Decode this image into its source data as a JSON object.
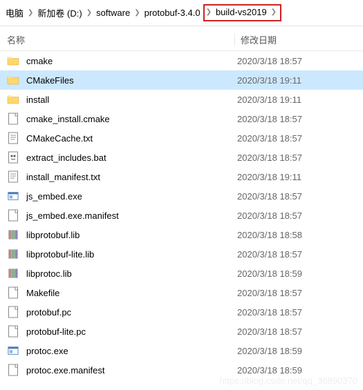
{
  "breadcrumb": {
    "items": [
      {
        "label": "电脑"
      },
      {
        "label": "新加卷 (D:)"
      },
      {
        "label": "software"
      },
      {
        "label": "protobuf-3.4.0"
      },
      {
        "label": "build-vs2019",
        "highlighted": true
      }
    ]
  },
  "columns": {
    "name": "名称",
    "date": "修改日期"
  },
  "files": [
    {
      "name": "cmake",
      "date": "2020/3/18 18:57",
      "type": "folder"
    },
    {
      "name": "CMakeFiles",
      "date": "2020/3/18 19:11",
      "type": "folder",
      "selected": true
    },
    {
      "name": "install",
      "date": "2020/3/18 19:11",
      "type": "folder"
    },
    {
      "name": "cmake_install.cmake",
      "date": "2020/3/18 18:57",
      "type": "file"
    },
    {
      "name": "CMakeCache.txt",
      "date": "2020/3/18 18:57",
      "type": "txt"
    },
    {
      "name": "extract_includes.bat",
      "date": "2020/3/18 18:57",
      "type": "bat"
    },
    {
      "name": "install_manifest.txt",
      "date": "2020/3/18 19:11",
      "type": "txt"
    },
    {
      "name": "js_embed.exe",
      "date": "2020/3/18 18:57",
      "type": "exe"
    },
    {
      "name": "js_embed.exe.manifest",
      "date": "2020/3/18 18:57",
      "type": "file"
    },
    {
      "name": "libprotobuf.lib",
      "date": "2020/3/18 18:58",
      "type": "lib"
    },
    {
      "name": "libprotobuf-lite.lib",
      "date": "2020/3/18 18:57",
      "type": "lib"
    },
    {
      "name": "libprotoc.lib",
      "date": "2020/3/18 18:59",
      "type": "lib"
    },
    {
      "name": "Makefile",
      "date": "2020/3/18 18:57",
      "type": "file"
    },
    {
      "name": "protobuf.pc",
      "date": "2020/3/18 18:57",
      "type": "file"
    },
    {
      "name": "protobuf-lite.pc",
      "date": "2020/3/18 18:57",
      "type": "file"
    },
    {
      "name": "protoc.exe",
      "date": "2020/3/18 18:59",
      "type": "exe"
    },
    {
      "name": "protoc.exe.manifest",
      "date": "2020/3/18 18:59",
      "type": "file"
    }
  ],
  "watermark": "https://blog.csdn.net/qq_36890370"
}
